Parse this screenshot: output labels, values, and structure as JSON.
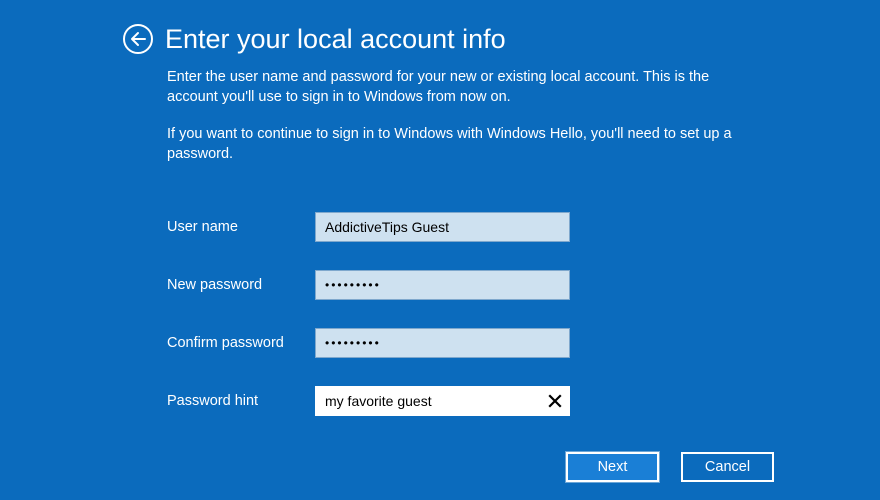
{
  "header": {
    "title": "Enter your local account info"
  },
  "intro": {
    "p1": "Enter the user name and password for your new or existing local account. This is the account you'll use to sign in to Windows from now on.",
    "p2": "If you want to continue to sign in to Windows with Windows Hello, you'll need to set up a password."
  },
  "form": {
    "username_label": "User name",
    "username_value": "AddictiveTips Guest",
    "newpassword_label": "New password",
    "newpassword_value": "•••••••••",
    "confirmpassword_label": "Confirm password",
    "confirmpassword_value": "•••••••••",
    "hint_label": "Password hint",
    "hint_value": "my favorite guest"
  },
  "buttons": {
    "next": "Next",
    "cancel": "Cancel"
  }
}
